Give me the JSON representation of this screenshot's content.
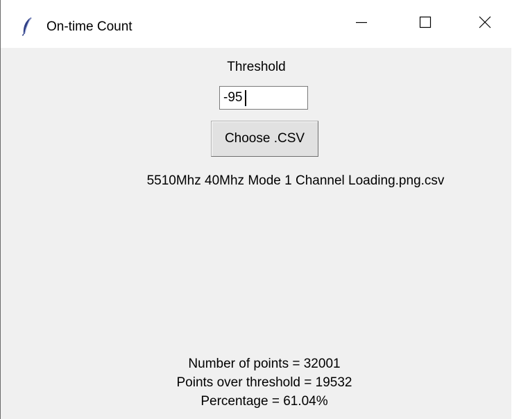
{
  "window": {
    "title": "On-time Count",
    "app_icon": "feather-icon",
    "controls": {
      "minimize_icon": "minimize-icon",
      "maximize_icon": "maximize-icon",
      "close_icon": "close-icon"
    }
  },
  "form": {
    "threshold_label": "Threshold",
    "threshold_value": "-95",
    "choose_button_label": "Choose .CSV",
    "selected_file": "5510Mhz 40Mhz Mode 1 Channel Loading.png.csv"
  },
  "results": {
    "points_line": "Number of points = 32001",
    "over_line": "Points over threshold = 19532",
    "percentage_line": "Percentage = 61.04%"
  },
  "colors": {
    "window_bg": "#f0f0f0",
    "titlebar_bg": "#ffffff",
    "button_bg": "#e1e1e1",
    "icon_feather": "#3a4a8c"
  }
}
